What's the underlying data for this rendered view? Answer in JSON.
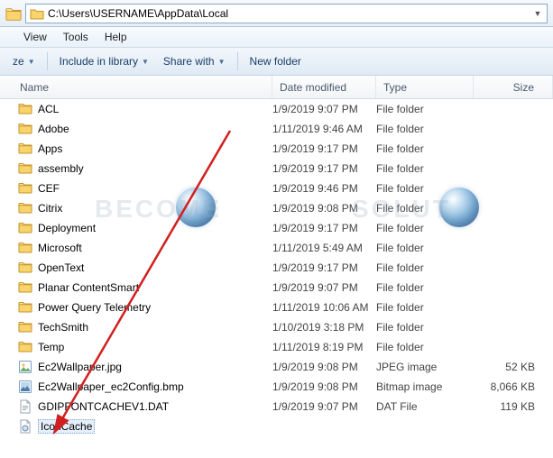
{
  "address": {
    "path": "C:\\Users\\USERNAME\\AppData\\Local"
  },
  "menu": {
    "view": "View",
    "tools": "Tools",
    "help": "Help"
  },
  "toolbar": {
    "organize": "ze",
    "include": "Include in library",
    "share": "Share with",
    "newfolder": "New folder"
  },
  "columns": {
    "name": "Name",
    "date": "Date modified",
    "type": "Type",
    "size": "Size"
  },
  "rows": [
    {
      "icon": "folder",
      "name": "ACL",
      "date": "1/9/2019 9:07 PM",
      "type": "File folder",
      "size": ""
    },
    {
      "icon": "folder",
      "name": "Adobe",
      "date": "1/11/2019 9:46 AM",
      "type": "File folder",
      "size": ""
    },
    {
      "icon": "folder",
      "name": "Apps",
      "date": "1/9/2019 9:17 PM",
      "type": "File folder",
      "size": ""
    },
    {
      "icon": "folder",
      "name": "assembly",
      "date": "1/9/2019 9:17 PM",
      "type": "File folder",
      "size": ""
    },
    {
      "icon": "folder",
      "name": "CEF",
      "date": "1/9/2019 9:46 PM",
      "type": "File folder",
      "size": ""
    },
    {
      "icon": "folder",
      "name": "Citrix",
      "date": "1/9/2019 9:08 PM",
      "type": "File folder",
      "size": ""
    },
    {
      "icon": "folder",
      "name": "Deployment",
      "date": "1/9/2019 9:17 PM",
      "type": "File folder",
      "size": ""
    },
    {
      "icon": "folder",
      "name": "Microsoft",
      "date": "1/11/2019 5:49 AM",
      "type": "File folder",
      "size": ""
    },
    {
      "icon": "folder",
      "name": "OpenText",
      "date": "1/9/2019 9:17 PM",
      "type": "File folder",
      "size": ""
    },
    {
      "icon": "folder",
      "name": "Planar ContentSmart",
      "date": "1/9/2019 9:07 PM",
      "type": "File folder",
      "size": ""
    },
    {
      "icon": "folder",
      "name": "Power Query Telemetry",
      "date": "1/11/2019 10:06 AM",
      "type": "File folder",
      "size": ""
    },
    {
      "icon": "folder",
      "name": "TechSmith",
      "date": "1/10/2019 3:18 PM",
      "type": "File folder",
      "size": ""
    },
    {
      "icon": "folder",
      "name": "Temp",
      "date": "1/11/2019 8:19 PM",
      "type": "File folder",
      "size": ""
    },
    {
      "icon": "jpeg",
      "name": "Ec2Wallpaper.jpg",
      "date": "1/9/2019 9:08 PM",
      "type": "JPEG image",
      "size": "52 KB"
    },
    {
      "icon": "bmp",
      "name": "Ec2Wallpaper_ec2Config.bmp",
      "date": "1/9/2019 9:08 PM",
      "type": "Bitmap image",
      "size": "8,066 KB"
    },
    {
      "icon": "dat",
      "name": "GDIPFONTCACHEV1.DAT",
      "date": "1/9/2019 9:07 PM",
      "type": "DAT File",
      "size": "119 KB"
    },
    {
      "icon": "db",
      "name": "IconCache",
      "date": "",
      "type": "",
      "size": "",
      "selected": true
    }
  ]
}
